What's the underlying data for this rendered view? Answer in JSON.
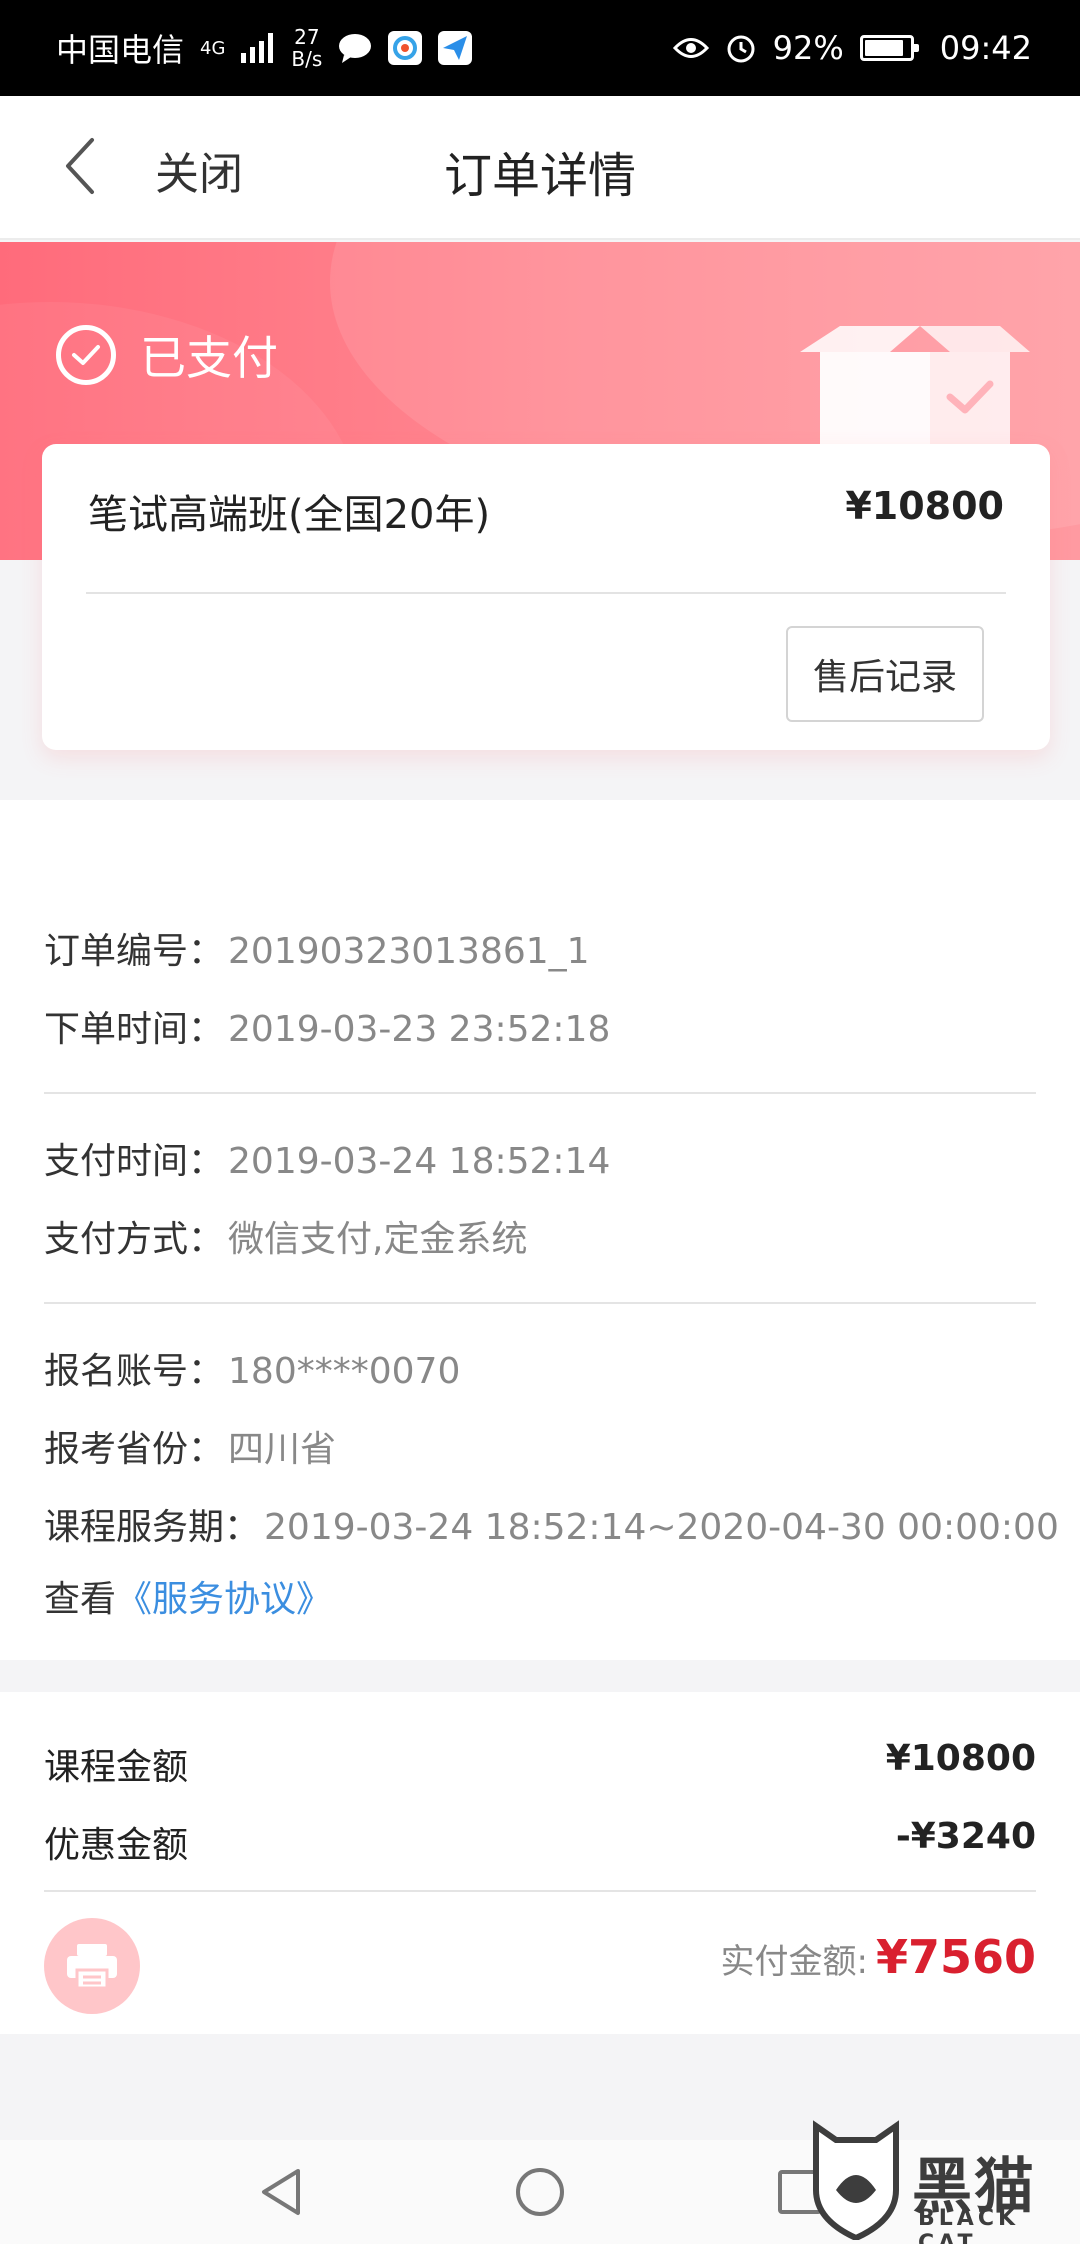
{
  "status_bar": {
    "carrier": "中国电信",
    "network": "4G",
    "speed_value": "27",
    "speed_unit": "B/s",
    "battery": "92%",
    "time": "09:42"
  },
  "nav": {
    "back_icon": "chevron-left-icon",
    "close_label": "关闭",
    "title": "订单详情"
  },
  "order_status": {
    "label": "已支付",
    "icon": "check-circle-icon"
  },
  "product": {
    "name": "笔试高端班(全国20年)",
    "price": "¥10800",
    "after_sales_label": "售后记录"
  },
  "order_info": {
    "order_no_label": "订单编号：",
    "order_no": "20190323013861_1",
    "order_time_label": "下单时间：",
    "order_time": "2019-03-23 23:52:18",
    "pay_time_label": "支付时间：",
    "pay_time": "2019-03-24 18:52:14",
    "pay_method_label": "支付方式：",
    "pay_method": "微信支付,定金系统",
    "account_label": "报名账号：",
    "account": "180****0070",
    "province_label": "报考省份：",
    "province": "四川省",
    "service_period_label": "课程服务期：",
    "service_period": "2019-03-24 18:52:14~2020-04-30 00:00:00",
    "view_label": "查看",
    "agreement_link": "《服务协议》"
  },
  "amounts": {
    "course_label": "课程金额",
    "course_value": "¥10800",
    "discount_label": "优惠金额",
    "discount_value": "-¥3240",
    "paid_label": "实付金额:",
    "paid_value": "¥7560"
  },
  "watermark": {
    "text": "黑猫",
    "sub": "BLACK CAT"
  },
  "colors": {
    "banner": "#ff7b86",
    "accent_red": "#d9202f",
    "link_blue": "#3b8ee0"
  }
}
